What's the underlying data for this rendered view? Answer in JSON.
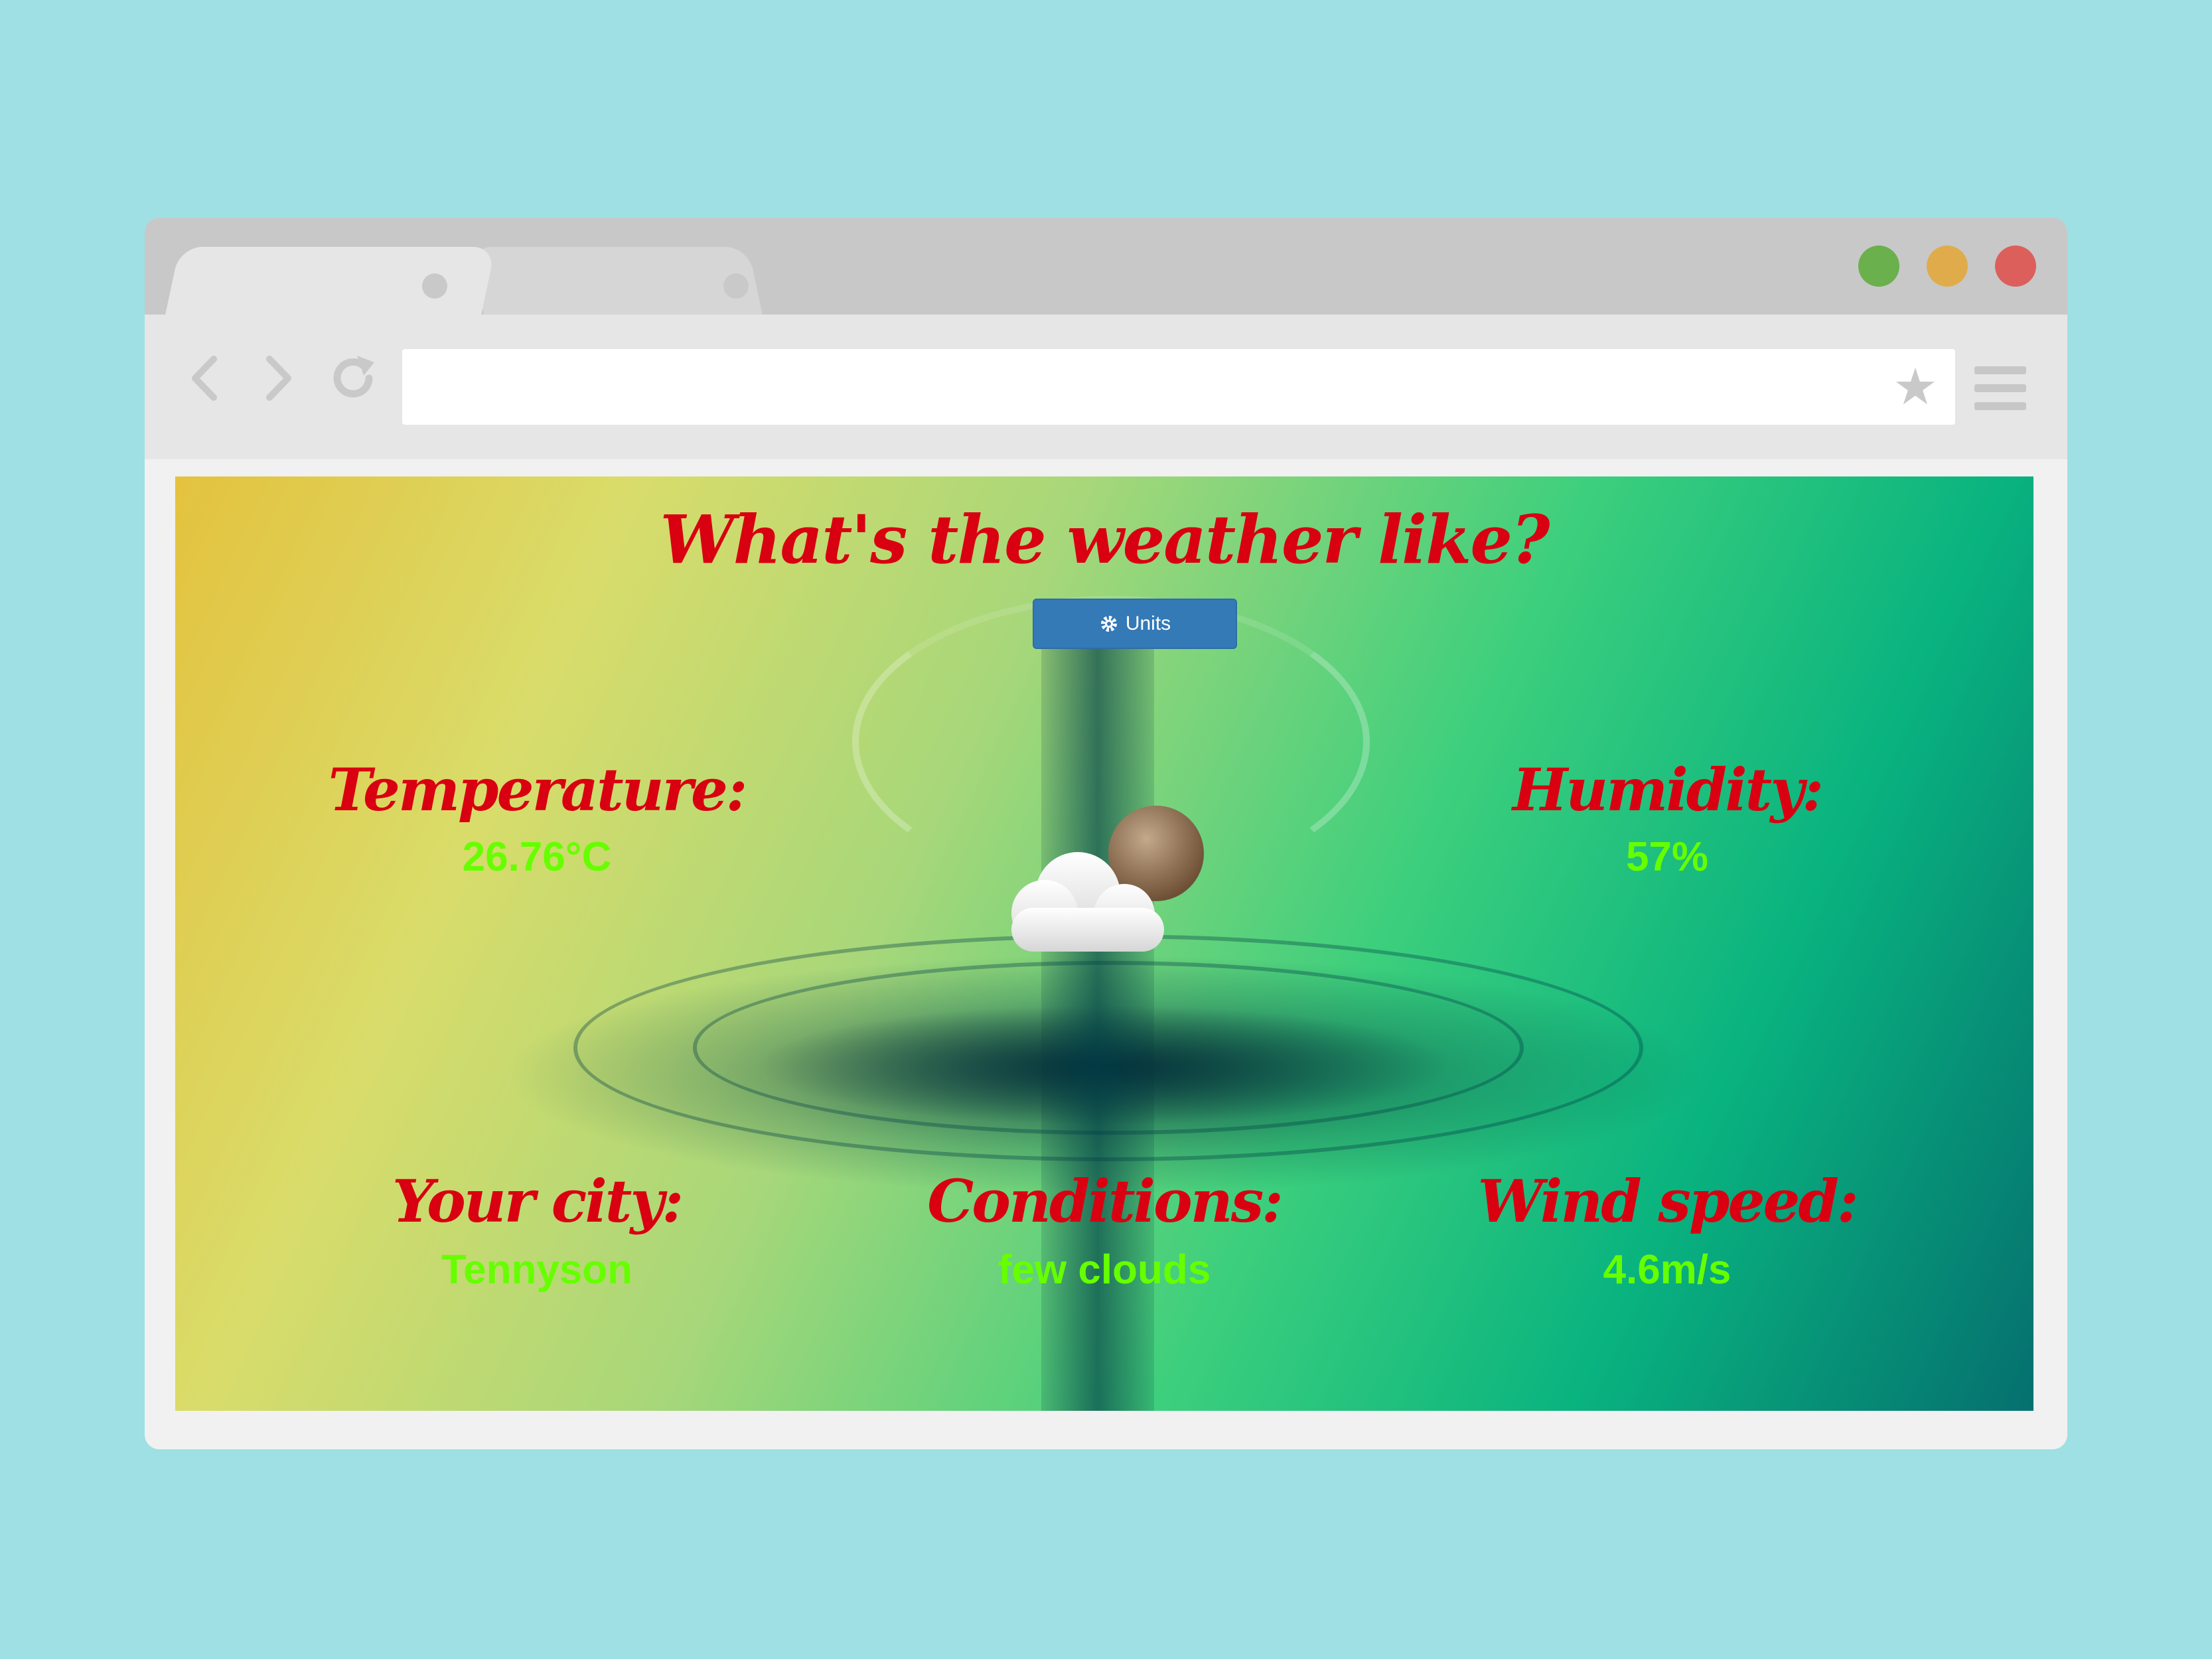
{
  "browser": {
    "traffic_lights": {
      "green": "#6ab04c",
      "yellow": "#e0ac4b",
      "red": "#dc5f5c"
    },
    "address_bar": {
      "value": ""
    },
    "icons": [
      "back-arrow-icon",
      "forward-arrow-icon",
      "reload-icon",
      "bookmark-star-icon",
      "hamburger-menu-icon"
    ]
  },
  "page": {
    "title": "What's the weather like?",
    "units_button": {
      "label": "Units",
      "icon": "gear-icon"
    },
    "weather_icon": "cloud-moon-icon",
    "fields": {
      "temperature": {
        "label": "Temperature:",
        "value": "26.76°C"
      },
      "humidity": {
        "label": "Humidity:",
        "value": "57%"
      },
      "city": {
        "label": "Your city:",
        "value": "Tennyson"
      },
      "conditions": {
        "label": "Conditions:",
        "value": "few clouds"
      },
      "wind_speed": {
        "label": "Wind speed:",
        "value": "4.6m/s"
      }
    },
    "colors": {
      "label": "#d80011",
      "value": "#66ff00",
      "button": "#337ab7"
    }
  }
}
